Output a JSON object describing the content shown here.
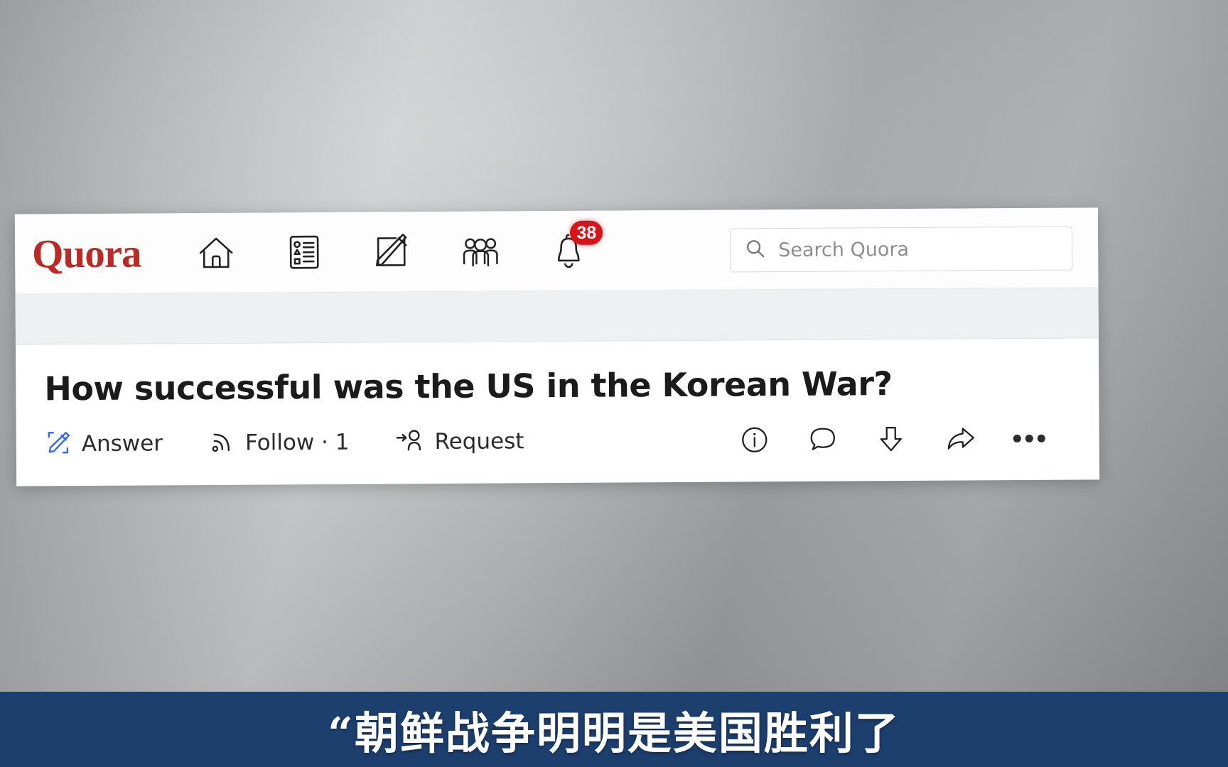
{
  "background": {
    "type": "grey-gradient-backdrop",
    "colors": [
      "#8f9193",
      "#c3c5c6",
      "#8b8d8f"
    ]
  },
  "quora": {
    "logo": "Quora",
    "logo_color": "#b92b27",
    "nav": [
      {
        "name": "home-icon",
        "label": "Home"
      },
      {
        "name": "feed-list-icon",
        "label": "Following"
      },
      {
        "name": "write-answer-icon",
        "label": "Answer"
      },
      {
        "name": "spaces-people-icon",
        "label": "Spaces"
      },
      {
        "name": "notifications-bell-icon",
        "label": "Notifications",
        "badge": "38",
        "badge_color": "#d6151b"
      }
    ],
    "search": {
      "placeholder": "Search Quora",
      "icon": "search-icon"
    },
    "question": {
      "title": "How successful was the US in the Korean War?",
      "actions": [
        {
          "icon": "pencil-answer-icon",
          "label": "Answer",
          "accent": "#2e69ff"
        },
        {
          "icon": "follow-rss-icon",
          "label": "Follow · 1"
        },
        {
          "icon": "request-person-icon",
          "label": "Request"
        }
      ],
      "right_actions": [
        {
          "icon": "info-circle-icon"
        },
        {
          "icon": "comment-bubble-icon"
        },
        {
          "icon": "downvote-arrow-icon"
        },
        {
          "icon": "share-arrow-icon"
        },
        {
          "icon": "more-dots-icon"
        }
      ]
    }
  },
  "subtitle": {
    "text": "“朝鲜战争明明是美国胜利了",
    "bar_color": "#1d3f6e",
    "text_color": "#ffffff"
  }
}
